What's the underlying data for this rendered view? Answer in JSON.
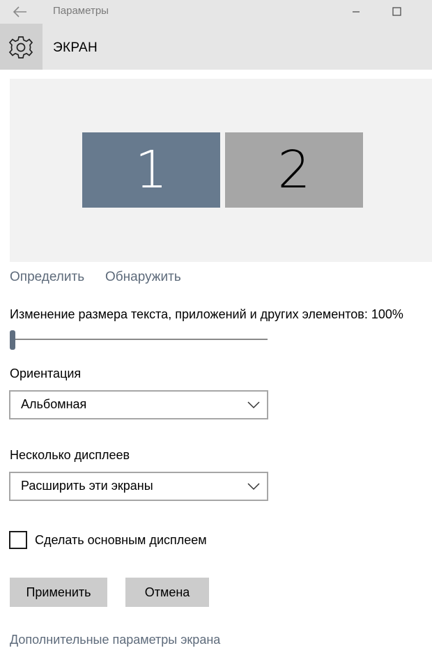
{
  "window": {
    "title": "Параметры"
  },
  "header": {
    "icon": "gear-icon",
    "title": "ЭКРАН"
  },
  "preview": {
    "monitors": [
      {
        "label": "1",
        "selected": true,
        "color": "#677a8e"
      },
      {
        "label": "2",
        "selected": false,
        "color": "#a6a6a6"
      }
    ]
  },
  "links": {
    "identify": "Определить",
    "detect": "Обнаружить",
    "advanced": "Дополнительные параметры экрана"
  },
  "scale": {
    "label": "Изменение размера текста, приложений и других элементов: 100%",
    "value_percent": 100,
    "slider_position": 0
  },
  "orientation": {
    "label": "Ориентация",
    "selected": "Альбомная"
  },
  "multiple_displays": {
    "label": "Несколько дисплеев",
    "selected": "Расширить эти экраны"
  },
  "primary_checkbox": {
    "label": "Сделать основным дисплеем",
    "checked": false
  },
  "buttons": {
    "apply": "Применить",
    "cancel": "Отмена"
  },
  "colors": {
    "accent": "#5f6e80",
    "link": "#5e6b7b",
    "titlebar": "#e6e6e6",
    "button": "#cccccc"
  }
}
